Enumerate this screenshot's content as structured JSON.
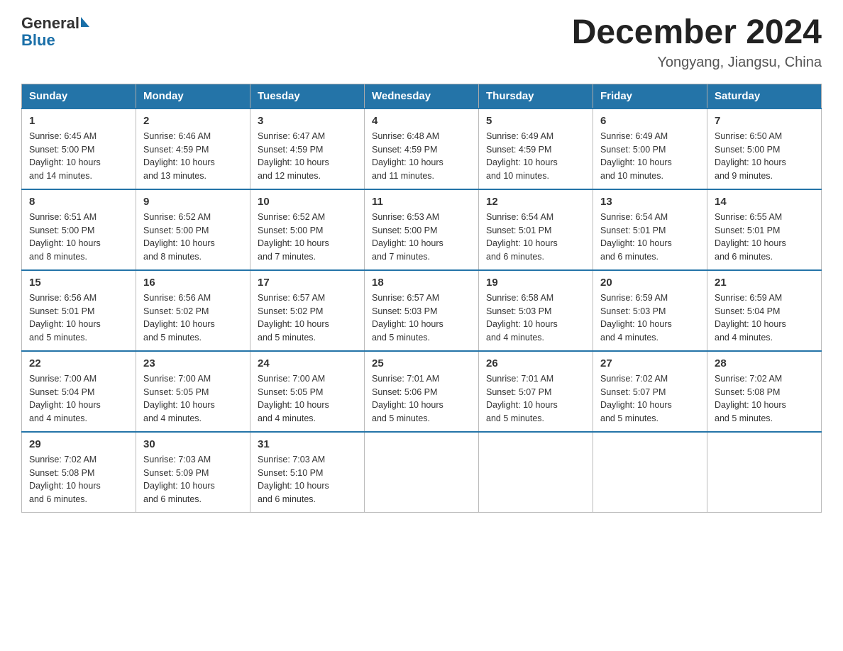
{
  "header": {
    "logo_general": "General",
    "logo_blue": "Blue",
    "month_title": "December 2024",
    "location": "Yongyang, Jiangsu, China"
  },
  "days_of_week": [
    "Sunday",
    "Monday",
    "Tuesday",
    "Wednesday",
    "Thursday",
    "Friday",
    "Saturday"
  ],
  "weeks": [
    [
      {
        "num": "1",
        "info": "Sunrise: 6:45 AM\nSunset: 5:00 PM\nDaylight: 10 hours\nand 14 minutes."
      },
      {
        "num": "2",
        "info": "Sunrise: 6:46 AM\nSunset: 4:59 PM\nDaylight: 10 hours\nand 13 minutes."
      },
      {
        "num": "3",
        "info": "Sunrise: 6:47 AM\nSunset: 4:59 PM\nDaylight: 10 hours\nand 12 minutes."
      },
      {
        "num": "4",
        "info": "Sunrise: 6:48 AM\nSunset: 4:59 PM\nDaylight: 10 hours\nand 11 minutes."
      },
      {
        "num": "5",
        "info": "Sunrise: 6:49 AM\nSunset: 4:59 PM\nDaylight: 10 hours\nand 10 minutes."
      },
      {
        "num": "6",
        "info": "Sunrise: 6:49 AM\nSunset: 5:00 PM\nDaylight: 10 hours\nand 10 minutes."
      },
      {
        "num": "7",
        "info": "Sunrise: 6:50 AM\nSunset: 5:00 PM\nDaylight: 10 hours\nand 9 minutes."
      }
    ],
    [
      {
        "num": "8",
        "info": "Sunrise: 6:51 AM\nSunset: 5:00 PM\nDaylight: 10 hours\nand 8 minutes."
      },
      {
        "num": "9",
        "info": "Sunrise: 6:52 AM\nSunset: 5:00 PM\nDaylight: 10 hours\nand 8 minutes."
      },
      {
        "num": "10",
        "info": "Sunrise: 6:52 AM\nSunset: 5:00 PM\nDaylight: 10 hours\nand 7 minutes."
      },
      {
        "num": "11",
        "info": "Sunrise: 6:53 AM\nSunset: 5:00 PM\nDaylight: 10 hours\nand 7 minutes."
      },
      {
        "num": "12",
        "info": "Sunrise: 6:54 AM\nSunset: 5:01 PM\nDaylight: 10 hours\nand 6 minutes."
      },
      {
        "num": "13",
        "info": "Sunrise: 6:54 AM\nSunset: 5:01 PM\nDaylight: 10 hours\nand 6 minutes."
      },
      {
        "num": "14",
        "info": "Sunrise: 6:55 AM\nSunset: 5:01 PM\nDaylight: 10 hours\nand 6 minutes."
      }
    ],
    [
      {
        "num": "15",
        "info": "Sunrise: 6:56 AM\nSunset: 5:01 PM\nDaylight: 10 hours\nand 5 minutes."
      },
      {
        "num": "16",
        "info": "Sunrise: 6:56 AM\nSunset: 5:02 PM\nDaylight: 10 hours\nand 5 minutes."
      },
      {
        "num": "17",
        "info": "Sunrise: 6:57 AM\nSunset: 5:02 PM\nDaylight: 10 hours\nand 5 minutes."
      },
      {
        "num": "18",
        "info": "Sunrise: 6:57 AM\nSunset: 5:03 PM\nDaylight: 10 hours\nand 5 minutes."
      },
      {
        "num": "19",
        "info": "Sunrise: 6:58 AM\nSunset: 5:03 PM\nDaylight: 10 hours\nand 4 minutes."
      },
      {
        "num": "20",
        "info": "Sunrise: 6:59 AM\nSunset: 5:03 PM\nDaylight: 10 hours\nand 4 minutes."
      },
      {
        "num": "21",
        "info": "Sunrise: 6:59 AM\nSunset: 5:04 PM\nDaylight: 10 hours\nand 4 minutes."
      }
    ],
    [
      {
        "num": "22",
        "info": "Sunrise: 7:00 AM\nSunset: 5:04 PM\nDaylight: 10 hours\nand 4 minutes."
      },
      {
        "num": "23",
        "info": "Sunrise: 7:00 AM\nSunset: 5:05 PM\nDaylight: 10 hours\nand 4 minutes."
      },
      {
        "num": "24",
        "info": "Sunrise: 7:00 AM\nSunset: 5:05 PM\nDaylight: 10 hours\nand 4 minutes."
      },
      {
        "num": "25",
        "info": "Sunrise: 7:01 AM\nSunset: 5:06 PM\nDaylight: 10 hours\nand 5 minutes."
      },
      {
        "num": "26",
        "info": "Sunrise: 7:01 AM\nSunset: 5:07 PM\nDaylight: 10 hours\nand 5 minutes."
      },
      {
        "num": "27",
        "info": "Sunrise: 7:02 AM\nSunset: 5:07 PM\nDaylight: 10 hours\nand 5 minutes."
      },
      {
        "num": "28",
        "info": "Sunrise: 7:02 AM\nSunset: 5:08 PM\nDaylight: 10 hours\nand 5 minutes."
      }
    ],
    [
      {
        "num": "29",
        "info": "Sunrise: 7:02 AM\nSunset: 5:08 PM\nDaylight: 10 hours\nand 6 minutes."
      },
      {
        "num": "30",
        "info": "Sunrise: 7:03 AM\nSunset: 5:09 PM\nDaylight: 10 hours\nand 6 minutes."
      },
      {
        "num": "31",
        "info": "Sunrise: 7:03 AM\nSunset: 5:10 PM\nDaylight: 10 hours\nand 6 minutes."
      },
      null,
      null,
      null,
      null
    ]
  ]
}
